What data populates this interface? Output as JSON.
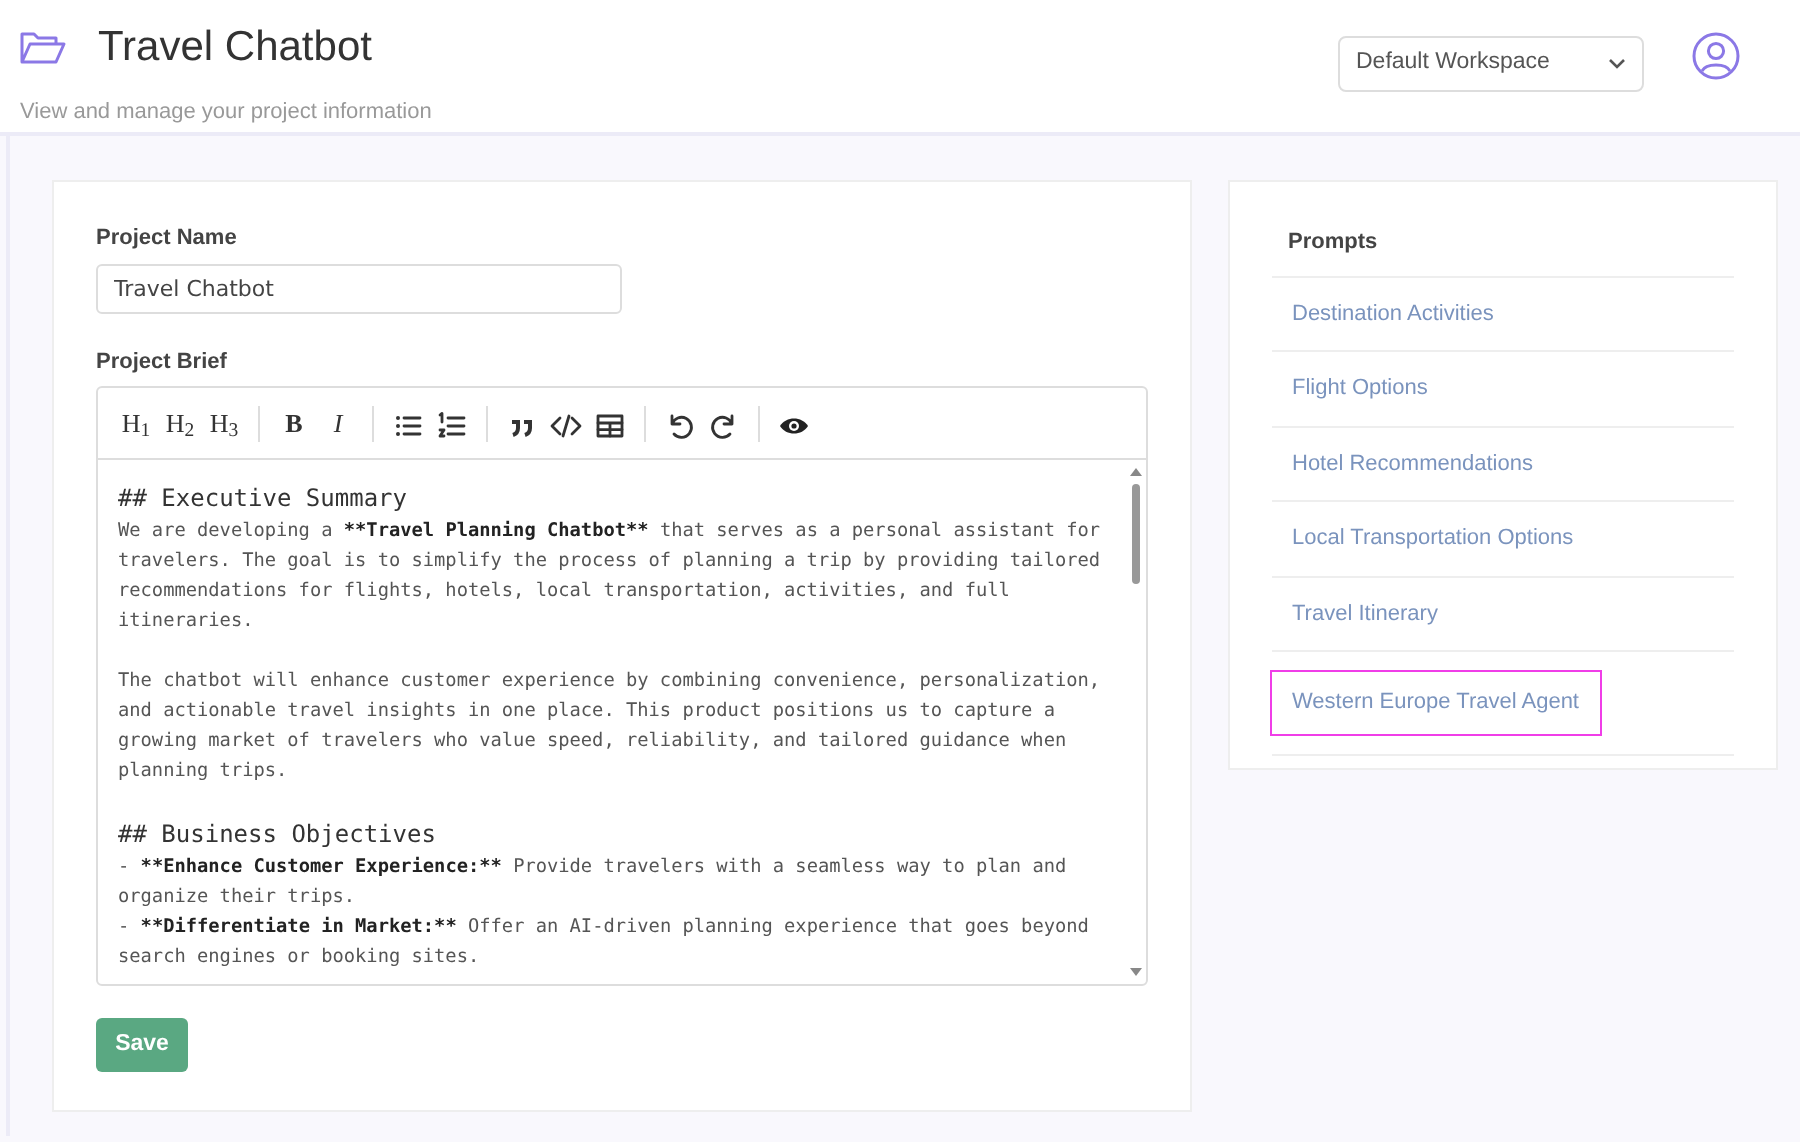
{
  "header": {
    "title": "Travel Chatbot",
    "subtitle": "View and manage your project information",
    "workspace": "Default Workspace"
  },
  "form": {
    "name_label": "Project Name",
    "name_value": "Travel Chatbot",
    "brief_label": "Project Brief",
    "toolbar": [
      [
        {
          "kind": "text",
          "label": "H$_{1}$"
        },
        {
          "kind": "text",
          "label": "H$_{2}$"
        },
        {
          "kind": "text",
          "label": "H$_{3}$"
        }
      ],
      [
        {
          "kind": "bold",
          "label": "B"
        },
        {
          "kind": "italic",
          "label": "I"
        }
      ],
      [
        {
          "kind": "bullet-list"
        },
        {
          "kind": "numbered-list"
        }
      ],
      [
        {
          "kind": "quote"
        },
        {
          "kind": "code"
        },
        {
          "kind": "table"
        }
      ],
      [
        {
          "kind": "undo"
        },
        {
          "kind": "redo"
        }
      ],
      [
        {
          "kind": "preview"
        }
      ]
    ],
    "brief": [
      {
        "kind": "heading",
        "segments": [
          {
            "text": "## Executive Summary",
            "bold": false
          }
        ]
      },
      {
        "kind": "paragraph",
        "segments": [
          {
            "text": "We are developing a ",
            "bold": false
          },
          {
            "text": "**Travel Planning Chatbot**",
            "bold": true
          },
          {
            "text": " that serves as a personal assistant for travelers. The goal is to simplify the process of planning a trip by providing tailored recommendations for flights, hotels, local transportation, activities, and full itineraries.",
            "bold": false
          }
        ]
      },
      {
        "kind": "paragraph",
        "segments": [
          {
            "text": "The chatbot will enhance customer experience by combining convenience, personalization, and actionable travel insights in one place. This product positions us to capture a growing market of travelers who value speed, reliability, and tailored guidance when planning trips.",
            "bold": false
          }
        ]
      },
      {
        "kind": "heading",
        "segments": [
          {
            "text": "## Business Objectives",
            "bold": false
          }
        ]
      },
      {
        "kind": "line",
        "segments": [
          {
            "text": "- ",
            "bold": false
          },
          {
            "text": "**Enhance Customer Experience:**",
            "bold": true
          },
          {
            "text": " Provide travelers with a seamless way to plan and organize their trips.",
            "bold": false
          }
        ]
      },
      {
        "kind": "line",
        "segments": [
          {
            "text": "- ",
            "bold": false
          },
          {
            "text": "**Differentiate in Market:**",
            "bold": true
          },
          {
            "text": " Offer an AI-driven planning experience that goes beyond search engines or booking sites.",
            "bold": false
          }
        ]
      }
    ],
    "save": "Save"
  },
  "prompts": {
    "title": "Prompts",
    "items": [
      {
        "label": "Destination Activities",
        "selected": false
      },
      {
        "label": "Flight Options",
        "selected": false
      },
      {
        "label": "Hotel Recommendations",
        "selected": false
      },
      {
        "label": "Local Transportation Options",
        "selected": false
      },
      {
        "label": "Travel Itinerary",
        "selected": false
      },
      {
        "label": "Western Europe Travel Agent",
        "selected": true
      }
    ]
  }
}
